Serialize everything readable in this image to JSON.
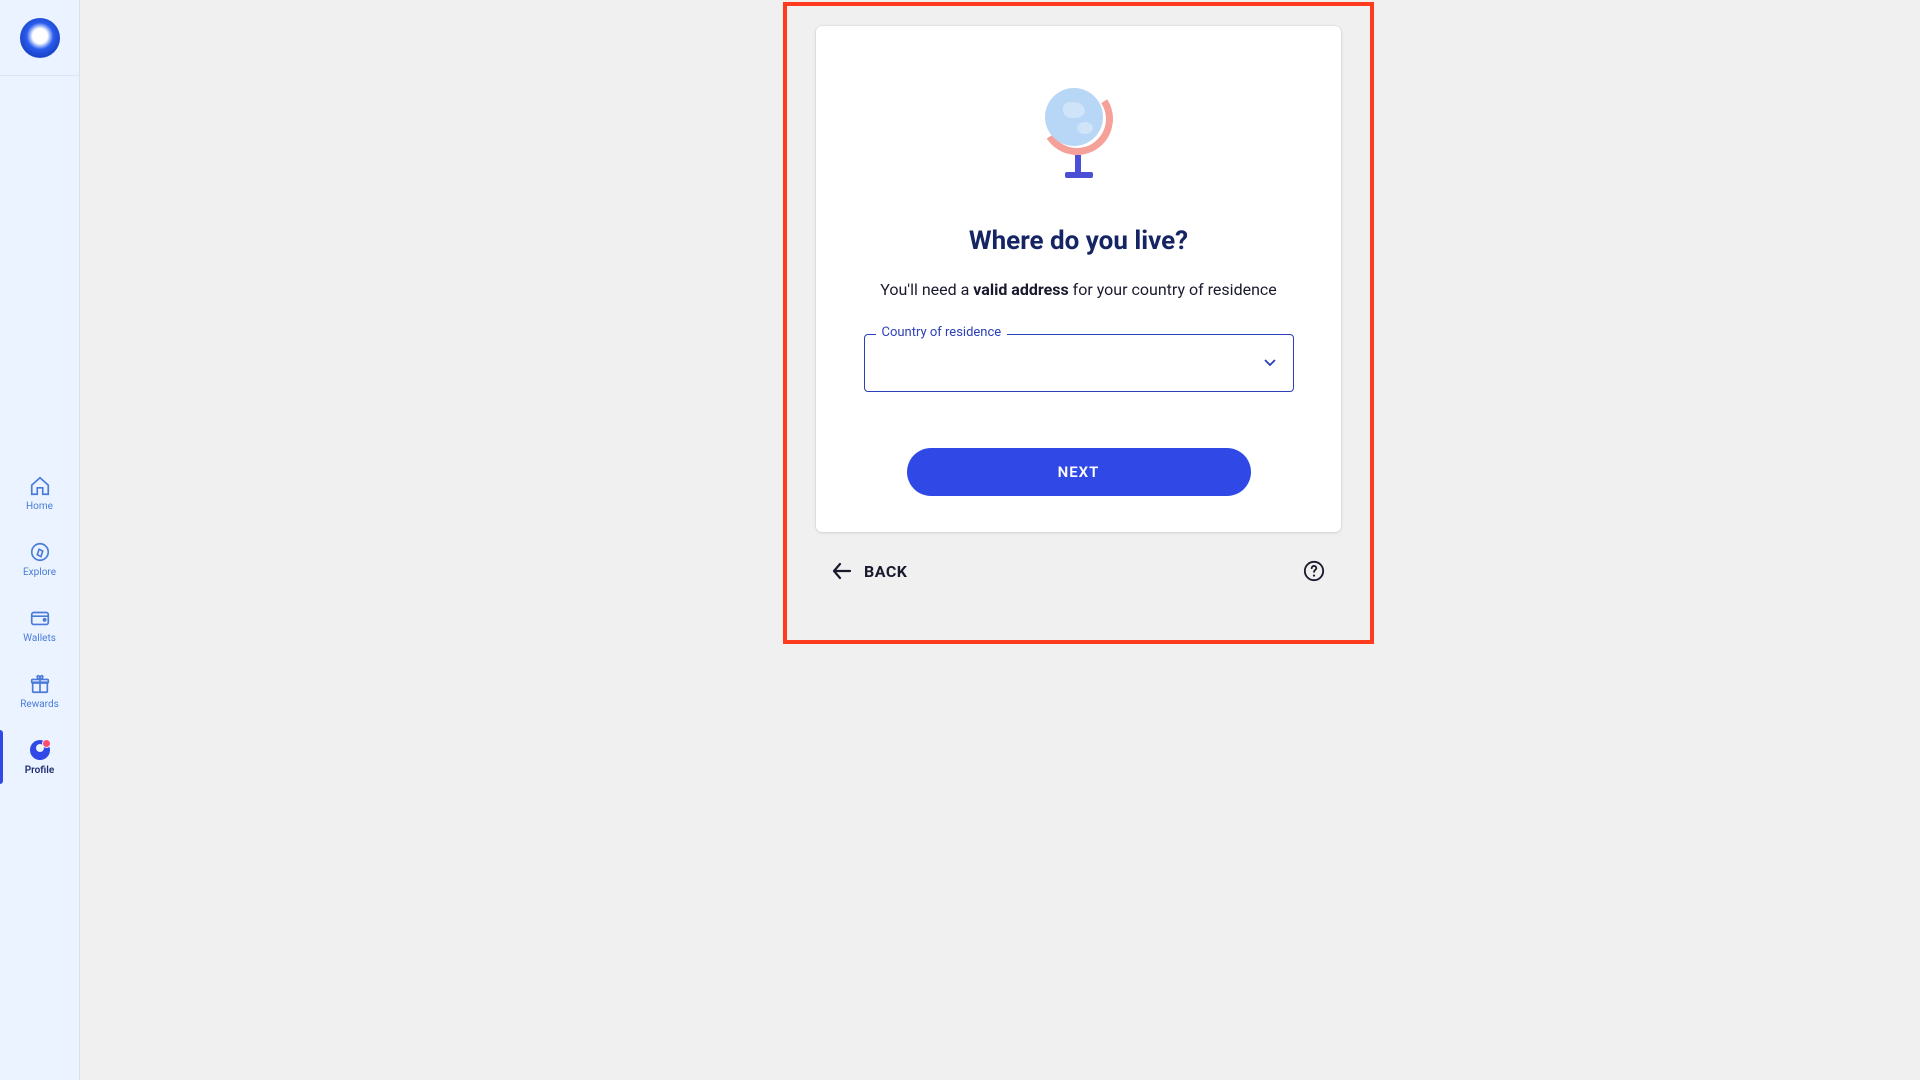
{
  "sidebar": {
    "items": [
      {
        "label": "Home"
      },
      {
        "label": "Explore"
      },
      {
        "label": "Wallets"
      },
      {
        "label": "Rewards"
      },
      {
        "label": "Profile"
      }
    ],
    "active_index": 4
  },
  "card": {
    "title": "Where do you live?",
    "subtitle_prefix": "You'll need a ",
    "subtitle_bold": "valid address",
    "subtitle_suffix": " for your country of residence",
    "select_label": "Country of residence",
    "select_value": "",
    "next_label": "NEXT"
  },
  "footer": {
    "back_label": "BACK"
  }
}
